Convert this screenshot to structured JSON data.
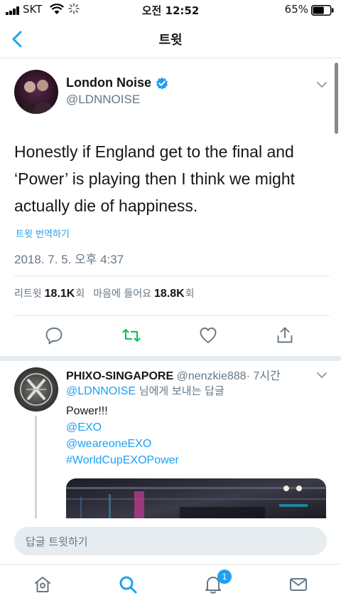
{
  "status_bar": {
    "carrier": "SKT",
    "time": "오전 12:52",
    "battery": "65%",
    "battery_level": 0.65
  },
  "nav": {
    "title": "트윗"
  },
  "tweet": {
    "name": "London Noise",
    "handle": "@LDNNOISE",
    "verified": true,
    "text": "Honestly if England get to the final and ‘Power’ is playing then I think we might actually die of happiness.",
    "translate": "트윗 번역하기",
    "timestamp": "2018. 7. 5. 오후 4:37",
    "retweets_label": "리트윗",
    "retweets": "18.1K",
    "retweets_unit": "회",
    "likes_label": "마음에 들어요",
    "likes": "18.8K",
    "likes_unit": "회"
  },
  "reply": {
    "name": "PHIXO-SINGAPORE",
    "handle": "@nenzkie888",
    "time": "· 7시간",
    "reply_to_handle": "@LDNNOISE",
    "reply_to_suffix": " 님에게 보내는 답글",
    "body_line": "Power!!!",
    "links": [
      "@EXO",
      "@weareoneEXO",
      "#WorldCupEXOPower"
    ]
  },
  "composer": {
    "placeholder": "답글 트윗하기"
  },
  "tab_bar": {
    "notification_count": "1"
  },
  "colors": {
    "accent": "#1da1f2",
    "retweet_green": "#17bf63",
    "muted": "#657786"
  }
}
